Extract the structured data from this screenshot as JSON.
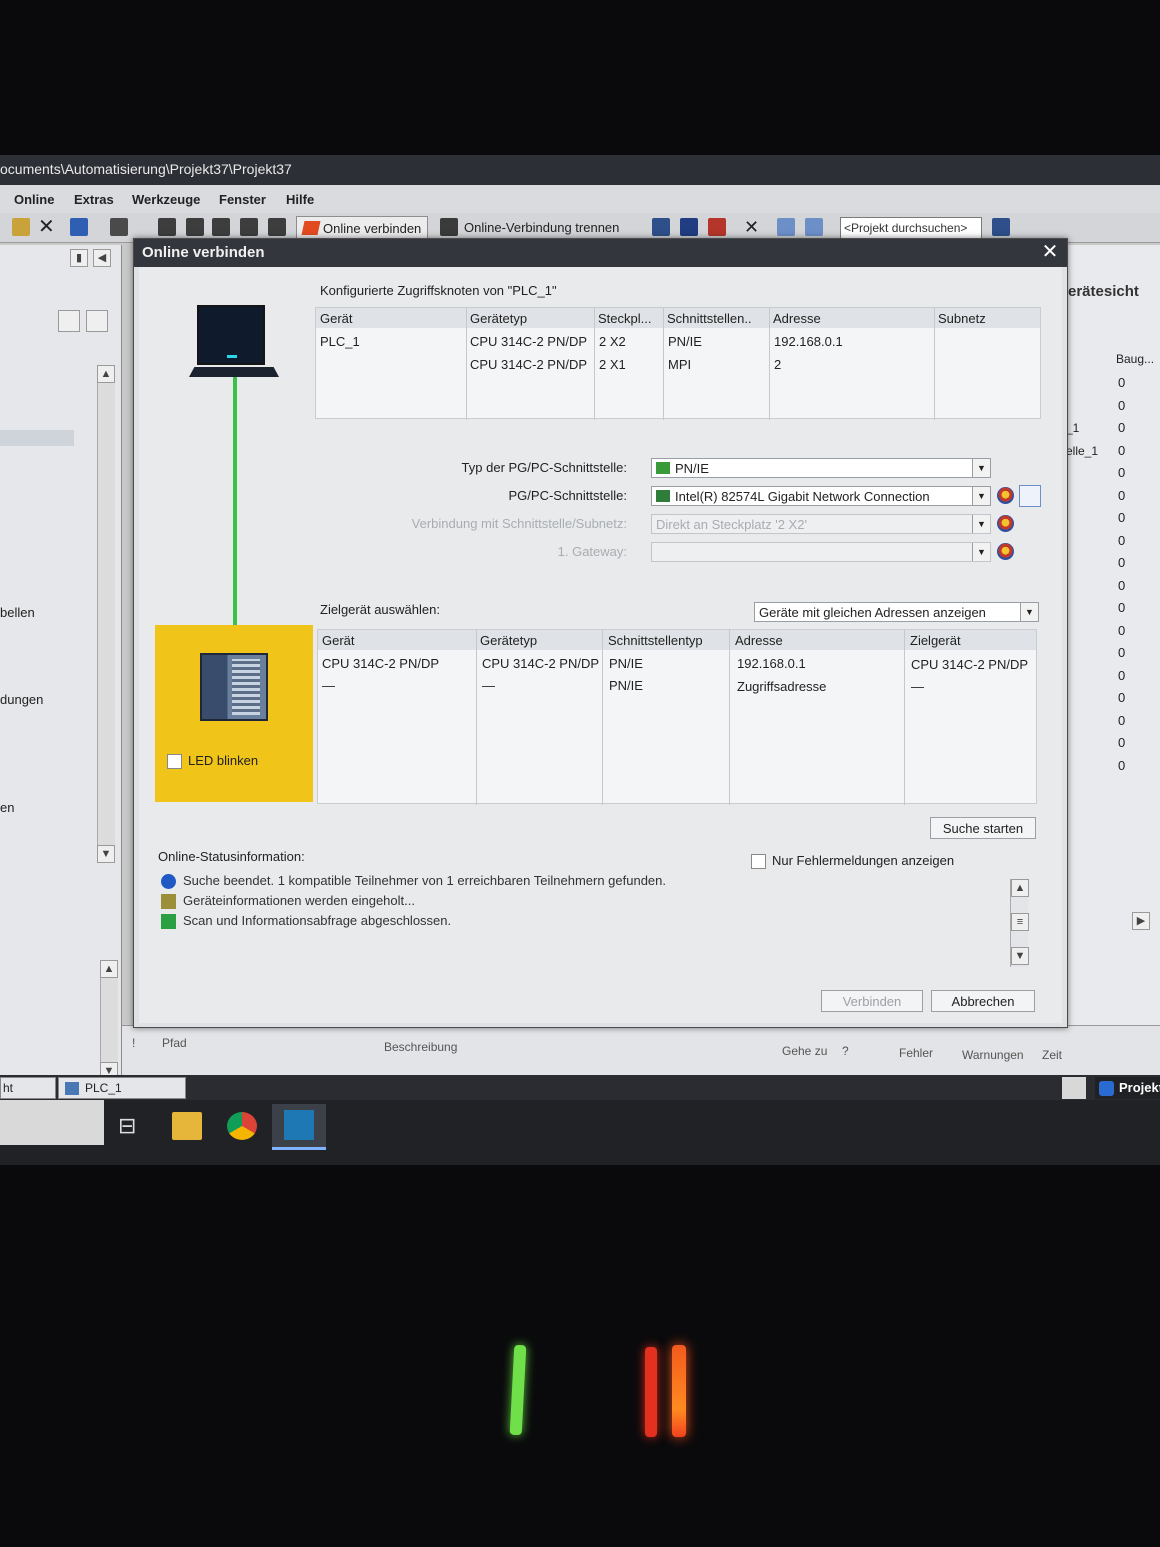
{
  "window": {
    "path": "ocuments\\Automatisierung\\Projekt37\\Projekt37"
  },
  "menu": [
    "Online",
    "Extras",
    "Werkzeuge",
    "Fenster",
    "Hilfe"
  ],
  "toolbar": {
    "online_connect": "Online verbinden",
    "online_disconnect": "Online-Verbindung trennen",
    "search_placeholder": "<Projekt durchsuchen>"
  },
  "left_panel": {
    "items": [
      "bellen",
      "dungen",
      "en"
    ]
  },
  "right_panel": {
    "title": "erätesicht",
    "column": "Baug...",
    "labels": [
      "_1",
      "elle_1"
    ],
    "values": [
      "0",
      "0",
      "0",
      "0",
      "0",
      "0",
      "0",
      "0",
      "0",
      "0",
      "0",
      "0",
      "0",
      "0",
      "0",
      "0",
      "0",
      "0"
    ]
  },
  "bottom_panel": {
    "pfad": "Pfad",
    "beschreibung": "Beschreibung",
    "gehe_zu": "Gehe zu",
    "fragezeichen": "?",
    "fehler": "Fehler",
    "warnungen": "Warnungen",
    "zeit": "Zeit",
    "exclaim": "!"
  },
  "status_strip": {
    "left_tab": "ht",
    "plc_tab": "PLC_1",
    "project_badge": "Projekt"
  },
  "dialog": {
    "title": "Online verbinden",
    "configured_title": "Konfigurierte Zugriffsknoten von \"PLC_1\"",
    "configured_table": {
      "headers": [
        "Gerät",
        "Gerätetyp",
        "Steckpl...",
        "Schnittstellen..",
        "Adresse",
        "Subnetz"
      ],
      "rows": [
        [
          "PLC_1",
          "CPU 314C-2 PN/DP",
          "2 X2",
          "PN/IE",
          "192.168.0.1",
          ""
        ],
        [
          "",
          "CPU 314C-2 PN/DP",
          "2 X1",
          "MPI",
          "2",
          ""
        ]
      ]
    },
    "form": {
      "type_label": "Typ der PG/PC-Schnittstelle:",
      "type_value": "PN/IE",
      "iface_label": "PG/PC-Schnittstelle:",
      "iface_value": "Intel(R) 82574L Gigabit Network Connection",
      "subnet_label": "Verbindung mit Schnittstelle/Subnetz:",
      "subnet_value": "Direkt an Steckplatz '2 X2'",
      "gateway_label": "1. Gateway:",
      "gateway_value": ""
    },
    "target_title": "Zielgerät auswählen:",
    "target_filter": "Geräte mit gleichen Adressen anzeigen",
    "target_table": {
      "headers": [
        "Gerät",
        "Gerätetyp",
        "Schnittstellentyp",
        "Adresse",
        "Zielgerät"
      ],
      "rows": [
        [
          "CPU 314C-2 PN/DP",
          "CPU 314C-2 PN/DP",
          "PN/IE",
          "192.168.0.1",
          "CPU 314C-2 PN/DP"
        ],
        [
          "—",
          "—",
          "PN/IE",
          "Zugriffsadresse",
          "—"
        ]
      ]
    },
    "led_label": "LED blinken",
    "search_button": "Suche starten",
    "status_title": "Online-Statusinformation:",
    "errors_only": "Nur Fehlermeldungen anzeigen",
    "status_messages": [
      "Suche beendet. 1 kompatible Teilnehmer von 1 erreichbaren Teilnehmern gefunden.",
      "Geräteinformationen werden eingeholt...",
      "Scan und Informationsabfrage abgeschlossen."
    ],
    "connect_button": "Verbinden",
    "cancel_button": "Abbrechen"
  },
  "colors": {
    "plc_highlight": "#f0c418",
    "link_line": "#39c24a",
    "title_bar": "#33363c"
  }
}
